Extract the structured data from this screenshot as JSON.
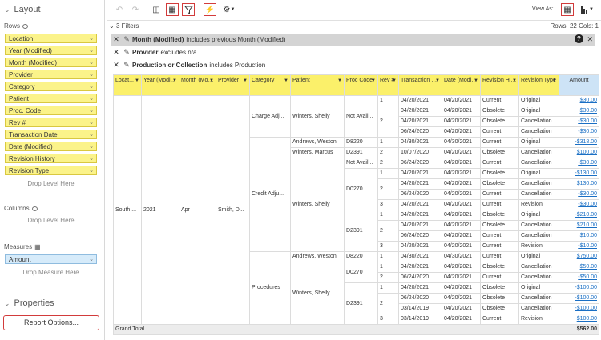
{
  "left_panel": {
    "layout_title": "Layout",
    "rows_title": "Rows",
    "row_fields": [
      "Location",
      "Year (Modified)",
      "Month (Modified)",
      "Provider",
      "Category",
      "Patient",
      "Proc. Code",
      "Rev #",
      "Transaction Date",
      "Date (Modified)",
      "Revision History",
      "Revision Type"
    ],
    "rows_drop": "Drop Level Here",
    "columns_title": "Columns",
    "columns_drop": "Drop Level Here",
    "measures_title": "Measures",
    "measure_fields": [
      "Amount"
    ],
    "measures_drop": "Drop Measure Here",
    "properties_title": "Properties",
    "report_options": "Report Options..."
  },
  "toolbar": {
    "view_as": "View As:"
  },
  "status": {
    "filters_label": "3 Filters",
    "rows_cols": "Rows: 22  Cols: 1"
  },
  "filters": [
    {
      "field": "Month (Modified)",
      "rest": "includes previous Month (Modified)"
    },
    {
      "field": "Provider",
      "rest": "excludes n/a"
    },
    {
      "field": "Production or Collection",
      "rest": "includes Production"
    }
  ],
  "grid": {
    "headers": [
      "Locat...",
      "Year (Modifi...",
      "Month (Modifie...",
      "Provider",
      "Category",
      "Patient",
      "Proc Code",
      "Rev #",
      "Transaction Date",
      "Date (Modified)",
      "Revision History",
      "Revision Type",
      "Amount"
    ],
    "location": "South ...",
    "year": "2021",
    "month": "Apr",
    "provider": "Smith, D...",
    "categories": [
      "Charge Adj...",
      "Credit Adju...",
      "Procedures"
    ],
    "patients": [
      "Winters, Shelly",
      "Andrews, Weston",
      "Winters, Marcus",
      "Winters, Shelly",
      "Andrews, Weston",
      "Winters, Shelly"
    ],
    "proc_codes": [
      "Not Avail...",
      "D8220",
      "D2391",
      "Not Avail...",
      "D0270",
      "D2391",
      "D8220",
      "D0270",
      "D2391"
    ],
    "revs": [
      "1",
      "2",
      "1",
      "2",
      "2",
      "1",
      "2",
      "3",
      "1",
      "2",
      "3",
      "1",
      "1",
      "2",
      "1",
      "2",
      "3"
    ],
    "rows": [
      [
        "04/20/2021",
        "04/20/2021",
        "Current",
        "Original",
        "$30.00"
      ],
      [
        "04/20/2021",
        "04/20/2021",
        "Obsolete",
        "Original",
        "$30.00"
      ],
      [
        "04/20/2021",
        "04/20/2021",
        "Obsolete",
        "Cancellation",
        "-$30.00"
      ],
      [
        "06/24/2020",
        "04/20/2021",
        "Current",
        "Cancellation",
        "-$30.00"
      ],
      [
        "04/30/2021",
        "04/30/2021",
        "Current",
        "Original",
        "-$318.00"
      ],
      [
        "10/07/2020",
        "04/20/2021",
        "Obsolete",
        "Cancellation",
        "$100.00"
      ],
      [
        "06/24/2020",
        "04/20/2021",
        "Current",
        "Cancellation",
        "-$30.00"
      ],
      [
        "04/20/2021",
        "04/20/2021",
        "Obsolete",
        "Original",
        "-$130.00"
      ],
      [
        "04/20/2021",
        "04/20/2021",
        "Obsolete",
        "Cancellation",
        "$130.00"
      ],
      [
        "06/24/2020",
        "04/20/2021",
        "Current",
        "Cancellation",
        "-$30.00"
      ],
      [
        "04/20/2021",
        "04/20/2021",
        "Current",
        "Revision",
        "-$30.00"
      ],
      [
        "04/20/2021",
        "04/20/2021",
        "Obsolete",
        "Original",
        "-$210.00"
      ],
      [
        "04/20/2021",
        "04/20/2021",
        "Obsolete",
        "Cancellation",
        "$210.00"
      ],
      [
        "06/24/2020",
        "04/20/2021",
        "Current",
        "Cancellation",
        "$10.00"
      ],
      [
        "04/20/2021",
        "04/20/2021",
        "Current",
        "Revision",
        "-$10.00"
      ],
      [
        "04/30/2021",
        "04/30/2021",
        "Current",
        "Original",
        "$750.00"
      ],
      [
        "04/20/2021",
        "04/20/2021",
        "Obsolete",
        "Cancellation",
        "$50.00"
      ],
      [
        "06/24/2020",
        "04/20/2021",
        "Current",
        "Cancellation",
        "-$50.00"
      ],
      [
        "04/20/2021",
        "04/20/2021",
        "Obsolete",
        "Original",
        "-$100.00"
      ],
      [
        "06/24/2020",
        "04/20/2021",
        "Obsolete",
        "Cancellation",
        "-$100.00"
      ],
      [
        "03/14/2019",
        "04/20/2021",
        "Obsolete",
        "Cancellation",
        "-$100.00"
      ],
      [
        "03/14/2019",
        "04/20/2021",
        "Current",
        "Revision",
        "$100.00"
      ]
    ],
    "grand_total_label": "Grand Total",
    "grand_total_value": "$562.00"
  }
}
